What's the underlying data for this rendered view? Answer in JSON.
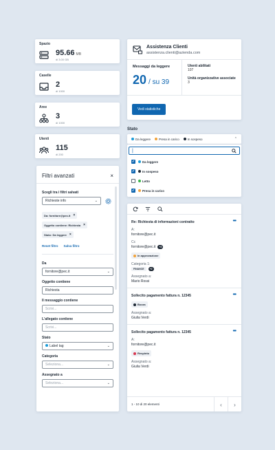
{
  "stats": [
    {
      "title": "Spazio",
      "value": "95.66",
      "unit": "MB",
      "sub": "di 3.00 GB"
    },
    {
      "title": "Caselle",
      "value": "2",
      "unit": "",
      "sub": "di 1000"
    },
    {
      "title": "Aree",
      "value": "3",
      "unit": "",
      "sub": "di 1000"
    },
    {
      "title": "Utenti",
      "value": "115",
      "unit": "",
      "sub": "di 200"
    }
  ],
  "assist": {
    "name": "Assistenza Clienti",
    "email": "assistenza.clienti@azienda.com",
    "unread_label": "Messaggi da leggere",
    "unread": "20",
    "total": "/ su 39",
    "users_label": "Utenti abilitati",
    "users": "107",
    "units_label": "Unità organizzative associate",
    "units": "3",
    "button": "Vedi statistiche"
  },
  "stato": {
    "label": "Stato",
    "chips": [
      {
        "label": "Da leggere",
        "color": "#1a9bd8"
      },
      {
        "label": "Presa in carico",
        "color": "#f2a33a"
      },
      {
        "label": "In sospeso",
        "color": "#1d2733"
      }
    ],
    "search_value": "|",
    "options": [
      {
        "label": "Da leggere",
        "checked": true,
        "color": "#1a9bd8"
      },
      {
        "label": "In sospeso",
        "checked": true,
        "color": "#1d2733"
      },
      {
        "label": "Letto",
        "checked": false,
        "color": "#3bb54a"
      },
      {
        "label": "Presa in carico",
        "checked": true,
        "color": "#f2a33a"
      }
    ]
  },
  "filters": {
    "title": "Filtri avanzati",
    "saved_label": "Scegli tra i filtri salvati",
    "saved_value": "Richieste info",
    "tags": [
      "Da: fornitore@pec.it",
      "Oggetto contiene: Richiesta",
      "Stato: Da leggere"
    ],
    "reset": "Reset filtro",
    "save": "Salva filtro",
    "from_label": "Da",
    "from_value": "fornitore@pec.it",
    "subject_label": "Oggetto contiene",
    "subject_value": "Richiesta",
    "message_label": "Il messaggio contiene",
    "message_ph": "Scrivi...",
    "attach_label": "L'allegato contiene",
    "attach_ph": "Scrivi...",
    "state_label": "Stato",
    "state_value": "Label tag",
    "category_label": "Categoria",
    "category_ph": "Seleziona...",
    "assigned_label": "Assegnato a",
    "assigned_ph": "Seleziona..."
  },
  "mails": {
    "items": [
      {
        "subject": "Re: Richiesta di informazioni contratto",
        "a_label": "A:",
        "a": "fornitore@pec.it",
        "cc_label": "Cc",
        "cc": "fornitore@pec.it",
        "cc_badge": "+3",
        "status": "In approvazione",
        "status_color": "#f2a33a",
        "cat_label": "Categoria 1:",
        "cat": "FINANCE",
        "cat_badge": "+2",
        "assigned_label": "Assegnato a:",
        "assigned": "Mario Rossi"
      },
      {
        "subject": "Sollecito pagamento fattura n. 12345",
        "status": "Bozza",
        "status_color": "#1d2733",
        "assigned_label": "Assegnato a:",
        "assigned": "Giulia Verdi"
      },
      {
        "subject": "Sollecito pagamento fattura n. 12345",
        "a_label": "A:",
        "a": "fornitore@pec.it",
        "status": "Respinto",
        "status_color": "#d9364f",
        "assigned_label": "Assegnato a:",
        "assigned": "Giulia Verdi"
      }
    ],
    "pager": "1 - 10 di 20 elementi"
  }
}
